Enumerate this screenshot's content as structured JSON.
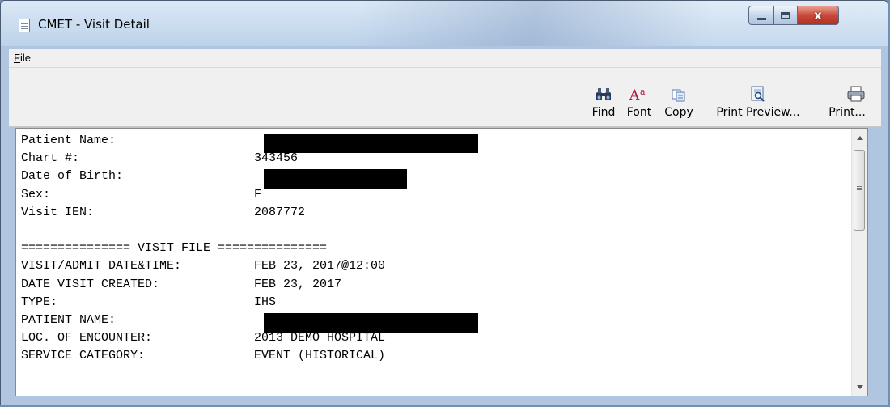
{
  "window": {
    "title": "CMET - Visit Detail",
    "controls": {
      "minimize_icon": "minimize-icon",
      "maximize_icon": "maximize-icon",
      "close_icon": "close-icon",
      "close_glyph": "x"
    }
  },
  "menu": {
    "file_underlined": "F",
    "file_rest": "ile"
  },
  "toolbar": {
    "find": "Find",
    "font": "Font",
    "copy_underlined": "C",
    "copy_rest": "opy",
    "print_preview_a": "Print Pre",
    "print_preview_u": "v",
    "print_preview_b": "iew...",
    "print_u": "P",
    "print_rest": "rint..."
  },
  "report": {
    "lines": [
      {
        "label": "Patient Name:",
        "value": "",
        "redacted": true
      },
      {
        "label": "Chart #:",
        "value": "343456"
      },
      {
        "label": "Date of Birth:",
        "value": "",
        "redacted": true
      },
      {
        "label": "Sex:",
        "value": "F"
      },
      {
        "label": "Visit IEN:",
        "value": "2087772"
      },
      {
        "label": "",
        "value": ""
      },
      {
        "label": "=============== VISIT FILE ===============",
        "value": ""
      },
      {
        "label": "VISIT/ADMIT DATE&TIME:",
        "value": "FEB 23, 2017@12:00"
      },
      {
        "label": "DATE VISIT CREATED:",
        "value": "FEB 23, 2017"
      },
      {
        "label": "TYPE:",
        "value": "IHS"
      },
      {
        "label": "PATIENT NAME:",
        "value": "",
        "redacted": true
      },
      {
        "label": "LOC. OF ENCOUNTER:",
        "value": "2013 DEMO HOSPITAL"
      },
      {
        "label": "SERVICE CATEGORY:",
        "value": "EVENT (HISTORICAL)"
      }
    ]
  },
  "colors": {
    "title_bar": "#bcd2ea",
    "close_button": "#c8493a",
    "redaction": "#000000"
  }
}
